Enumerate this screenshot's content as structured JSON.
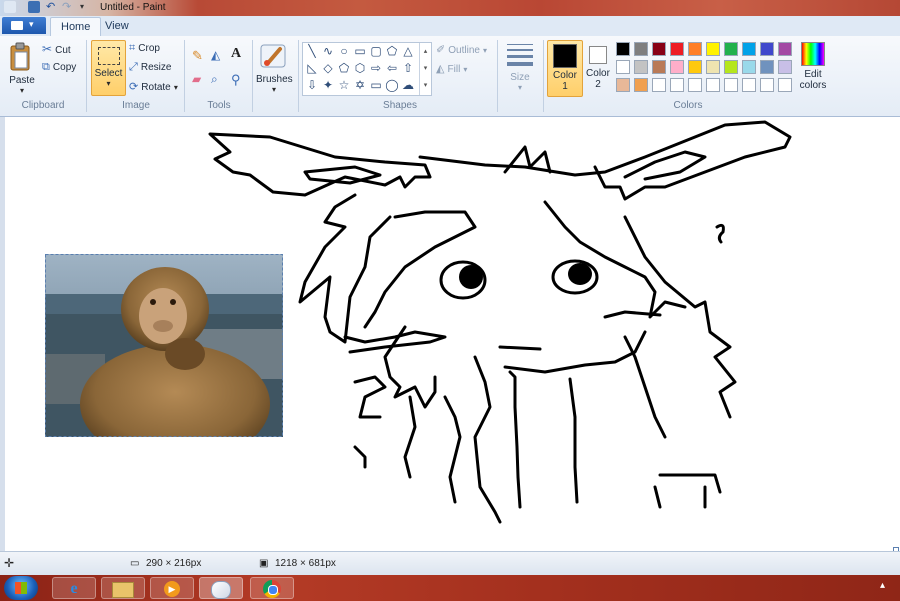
{
  "window": {
    "title": "Untitled - Paint"
  },
  "tabs": [
    {
      "label": "Home"
    },
    {
      "label": "View"
    }
  ],
  "clipboard": {
    "paste": "Paste",
    "cut": "Cut",
    "copy": "Copy",
    "group": "Clipboard"
  },
  "image": {
    "select": "Select",
    "crop": "Crop",
    "resize": "Resize",
    "rotate": "Rotate",
    "group": "Image"
  },
  "tools": {
    "group": "Tools"
  },
  "brushes": {
    "label": "Brushes"
  },
  "shapes": {
    "outline": "Outline",
    "fill": "Fill",
    "group": "Shapes"
  },
  "size": {
    "label": "Size"
  },
  "colors": {
    "color1_label": "Color",
    "color1_num": "1",
    "color2_label": "Color",
    "color2_num": "2",
    "edit_label_1": "Edit",
    "edit_label_2": "colors",
    "group": "Colors",
    "color1_value": "#000000",
    "color2_value": "#ffffff",
    "palette_row1": [
      "#000000",
      "#7f7f7f",
      "#880015",
      "#ed1c24",
      "#ff7f27",
      "#fff200",
      "#22b14c",
      "#00a2e8",
      "#3f48cc",
      "#a349a4"
    ],
    "palette_row2": [
      "#ffffff",
      "#c3c3c3",
      "#b97a57",
      "#ffaec9",
      "#ffc90e",
      "#efe4b0",
      "#b5e61d",
      "#99d9ea",
      "#7092be",
      "#c8bfe7"
    ],
    "palette_row3": [
      "#e8b898",
      "#f0a050",
      "#ffffff",
      "#ffffff",
      "#ffffff",
      "#ffffff",
      "#ffffff",
      "#ffffff",
      "#ffffff",
      "#ffffff"
    ]
  },
  "status": {
    "selection_size": "290 × 216px",
    "canvas_size": "1218 × 681px"
  }
}
